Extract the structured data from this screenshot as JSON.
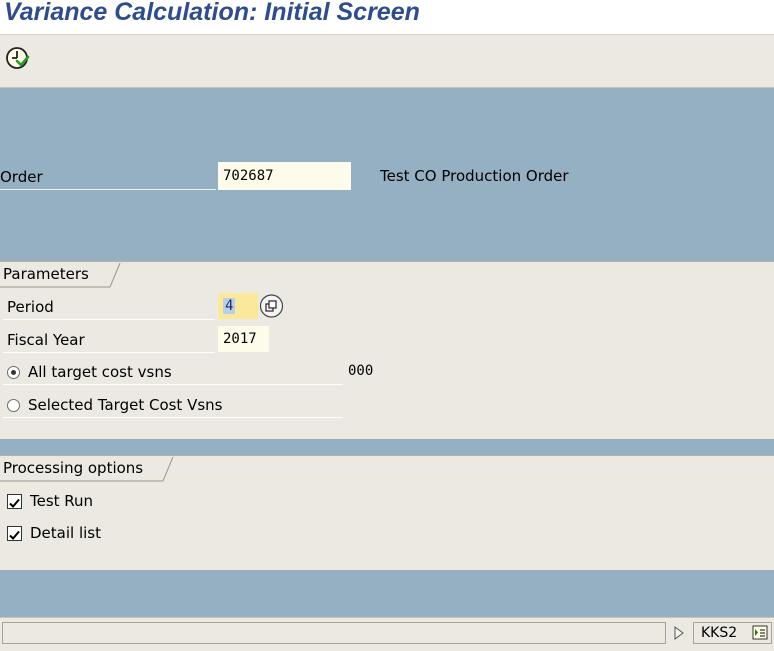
{
  "window": {
    "title": "Variance Calculation: Initial Screen"
  },
  "toolbar": {
    "execute_icon": "execute-clock-icon"
  },
  "header": {
    "order_label": "Order",
    "order_value": "702687",
    "order_description": "Test CO Production Order"
  },
  "parameters": {
    "group_title": "Parameters",
    "period_label": "Period",
    "period_value": "4",
    "fiscal_year_label": "Fiscal Year",
    "fiscal_year_value": "2017",
    "all_target_label": "All target cost vsns",
    "all_target_value": "000",
    "all_target_selected": true,
    "selected_target_label": "Selected Target Cost Vsns",
    "selected_target_selected": false
  },
  "processing": {
    "group_title": "Processing options",
    "test_run_label": "Test Run",
    "test_run_checked": true,
    "detail_list_label": "Detail list",
    "detail_list_checked": true
  },
  "statusbar": {
    "transaction_code": "KKS2",
    "expand_icon": "triangle-right-icon",
    "session_icon": "session-info-icon"
  },
  "colors": {
    "title": "#2f4d8a",
    "background_blue": "#95b0c3",
    "panel": "#ebe9e2",
    "input": "#fdfbe9"
  }
}
